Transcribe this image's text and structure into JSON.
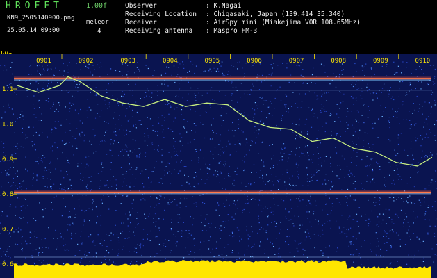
{
  "header": {
    "logo": "HROFFT",
    "version": "1.00f",
    "filename": "KN9_2505140900.png",
    "mode": "meleor",
    "datetime": "25.05.14 09:00",
    "number": "4",
    "observer_label": "Observer",
    "observer_value": ": K.Nagai",
    "location_label": "Receiving Location",
    "location_value": ": Chigasaki, Japan (139.414 35.340)",
    "receiver_label": "Receiver",
    "receiver_value": ": AirSpy mini (Miakejima VOR 108.65MHz)",
    "antenna_label": "Receiving antenna",
    "antenna_value": ": Maspro FM-3"
  },
  "colors": {
    "background": "#000000",
    "noise": "#1a2c8c",
    "label_yellow": "#ffe600",
    "trace_green": "#b8f070",
    "carrier": "#ff5a3a"
  },
  "chart_data": {
    "type": "heatmap",
    "ylabel": "kHz",
    "ylim": [
      0.6,
      1.2
    ],
    "y_ticks": [
      "1.1",
      "1.0",
      "0.9",
      "0.8",
      "0.7",
      "0.6"
    ],
    "x_ticks": [
      "0901",
      "0902",
      "0903",
      "0904",
      "0905",
      "0906",
      "0907",
      "0908",
      "0909",
      "0910"
    ],
    "carriers_khz": [
      1.13,
      0.805
    ],
    "doppler_trace": {
      "x": [
        0.0,
        0.5,
        1.0,
        1.2,
        1.5,
        2.0,
        2.5,
        3.0,
        3.5,
        4.0,
        4.5,
        5.0,
        5.5,
        6.0,
        6.5,
        7.0,
        7.5,
        8.0,
        8.5,
        9.0,
        9.5,
        9.85
      ],
      "y": [
        1.11,
        1.09,
        1.11,
        1.135,
        1.12,
        1.08,
        1.06,
        1.05,
        1.07,
        1.05,
        1.06,
        1.055,
        1.01,
        0.99,
        0.985,
        0.95,
        0.96,
        0.93,
        0.92,
        0.89,
        0.88,
        0.905
      ]
    }
  }
}
